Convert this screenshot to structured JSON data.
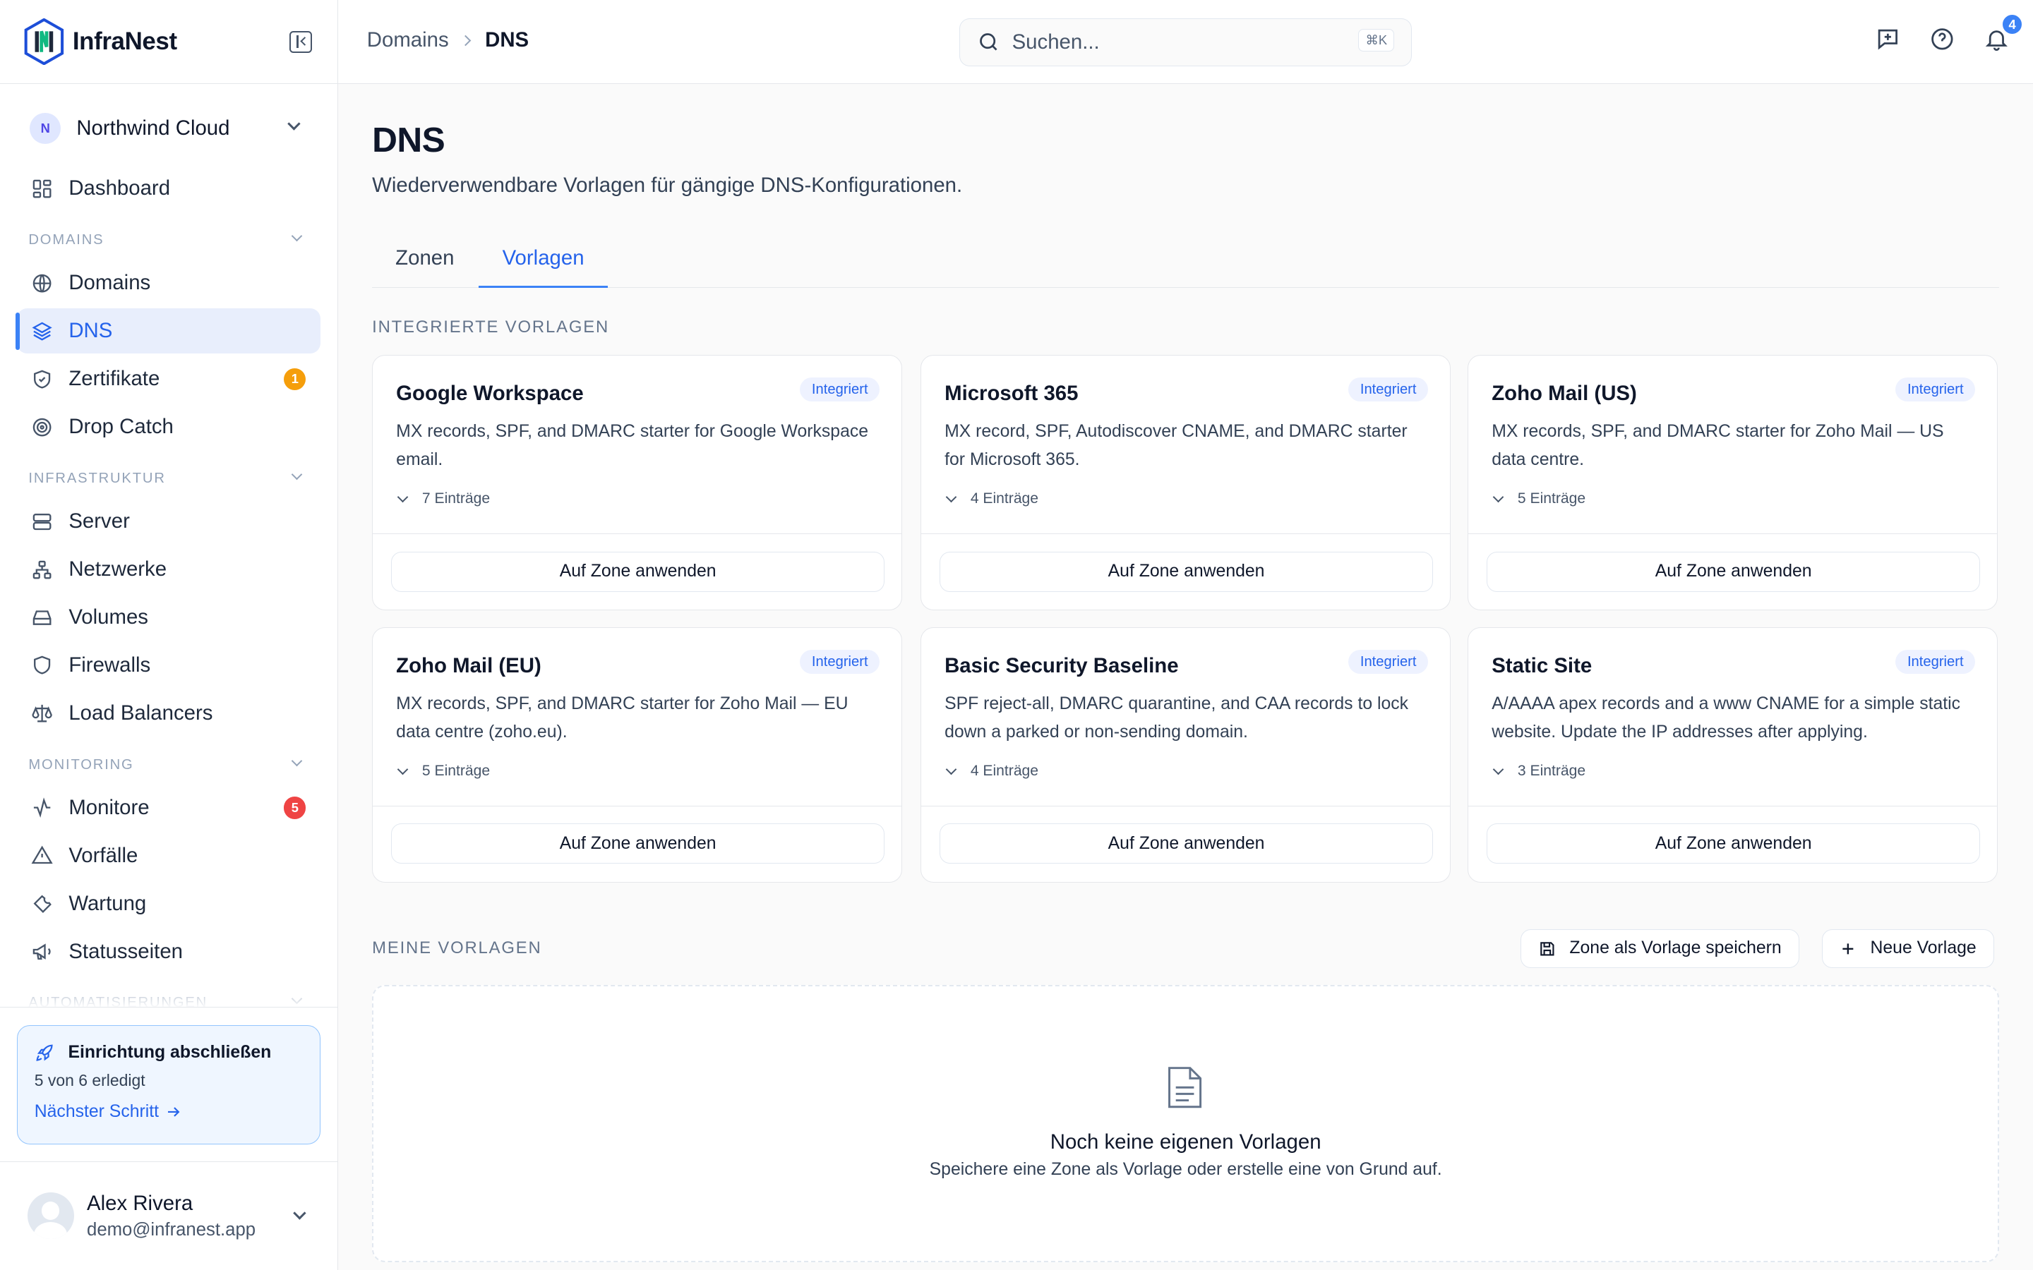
{
  "app": {
    "brand": "InfraNest"
  },
  "workspace": {
    "initial": "N",
    "name": "Northwind Cloud"
  },
  "sidebar": {
    "dashboard": "Dashboard",
    "sections": {
      "domains": "DOMAINS",
      "infrastructure": "INFRASTRUKTUR",
      "monitoring": "MONITORING",
      "automation": "AUTOMATISIERUNGEN"
    },
    "items": {
      "domains": "Domains",
      "dns": "DNS",
      "certificates": "Zertifikate",
      "certificates_badge": "1",
      "drop_catch": "Drop Catch",
      "servers": "Server",
      "networks": "Netzwerke",
      "volumes": "Volumes",
      "firewalls": "Firewalls",
      "load_balancers": "Load Balancers",
      "monitors": "Monitore",
      "monitors_badge": "5",
      "incidents": "Vorfälle",
      "maintenance": "Wartung",
      "status_pages": "Statusseiten"
    },
    "badge_colors": {
      "warning": "#f59e0b",
      "danger": "#ef4444"
    }
  },
  "setup": {
    "title": "Einrichtung abschließen",
    "progress": "5 von 6 erledigt",
    "next": "Nächster Schritt"
  },
  "user": {
    "name": "Alex Rivera",
    "email": "demo@infranest.app"
  },
  "topbar": {
    "breadcrumb": [
      "Domains",
      "DNS"
    ],
    "search_placeholder": "Suchen...",
    "search_shortcut": "⌘K",
    "notification_count": "4"
  },
  "page": {
    "title": "DNS",
    "subtitle": "Wiederverwendbare Vorlagen für gängige DNS-Konfigurationen.",
    "tabs": [
      "Zonen",
      "Vorlagen"
    ],
    "active_tab": "Vorlagen"
  },
  "builtin": {
    "label": "INTEGRIERTE VORLAGEN",
    "badge": "Integriert",
    "apply_label": "Auf Zone anwenden",
    "templates": [
      {
        "name": "Google Workspace",
        "description": "MX records, SPF, and DMARC starter for Google Workspace email.",
        "count": "7 Einträge"
      },
      {
        "name": "Microsoft 365",
        "description": "MX record, SPF, Autodiscover CNAME, and DMARC starter for Microsoft 365.",
        "count": "4 Einträge"
      },
      {
        "name": "Zoho Mail (US)",
        "description": "MX records, SPF, and DMARC starter for Zoho Mail — US data centre.",
        "count": "5 Einträge"
      },
      {
        "name": "Zoho Mail (EU)",
        "description": "MX records, SPF, and DMARC starter for Zoho Mail — EU data centre (zoho.eu).",
        "count": "5 Einträge"
      },
      {
        "name": "Basic Security Baseline",
        "description": "SPF reject-all, DMARC quarantine, and CAA records to lock down a parked or non-sending domain.",
        "count": "4 Einträge"
      },
      {
        "name": "Static Site",
        "description": "A/AAAA apex records and a www CNAME for a simple static website. Update the IP addresses after applying.",
        "count": "3 Einträge"
      }
    ]
  },
  "mine": {
    "label": "MEINE VORLAGEN",
    "save_zone": "Zone als Vorlage speichern",
    "new_template": "Neue Vorlage",
    "empty_title": "Noch keine eigenen Vorlagen",
    "empty_subtitle": "Speichere eine Zone als Vorlage oder erstelle eine von Grund auf."
  },
  "colors": {
    "accent": "#3b82f6",
    "link": "#2563eb"
  }
}
